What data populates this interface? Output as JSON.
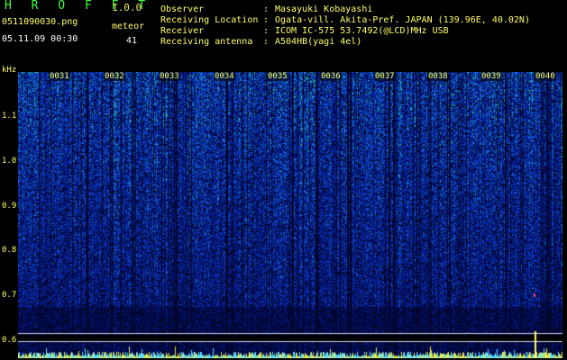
{
  "app": {
    "name": "H R O F F T",
    "version": "1.0.0"
  },
  "file": {
    "name": "0511090030.png",
    "datetime": "05.11.09 00:30"
  },
  "meteor": {
    "label": "meteor",
    "count": "41"
  },
  "info": [
    {
      "label": "Observer",
      "value": "Masayuki Kobayashi"
    },
    {
      "label": "Receiving Location",
      "value": "Ogata-vill. Akita-Pref. JAPAN (139.96E, 40.02N)"
    },
    {
      "label": "Receiver",
      "value": "ICOM IC-575 53.7492(@LCD)MHz USB"
    },
    {
      "label": "Receiving antenna",
      "value": "A504HB(yagi 4el)"
    }
  ],
  "y_axis": {
    "unit": "kHz",
    "ticks": [
      "1.1",
      "1.0",
      "0.9",
      "0.8",
      "0.7",
      "0.6"
    ]
  },
  "minute_marks": [
    "0031",
    "0032",
    "0033",
    "0034",
    "0035",
    "0036",
    "0037",
    "0038",
    "0039",
    "0040"
  ],
  "colors": {
    "label": "#ffff66",
    "brand": "#39ff3a",
    "value": "#ffffff",
    "bg": "#000000"
  }
}
